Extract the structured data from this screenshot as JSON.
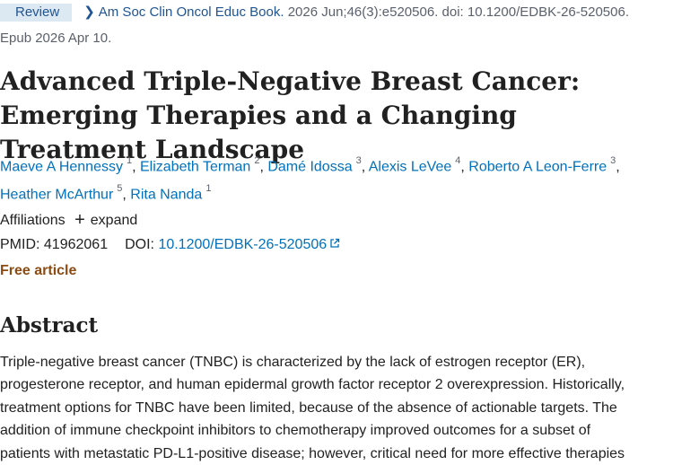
{
  "header": {
    "badge": "Review",
    "journal": "Am Soc Clin Oncol Educ Book.",
    "citation": " 2026 Jun;46(3):e520506. doi: 10.1200/EDBK-26-520506.",
    "epub": "Epub 2026 Apr 10."
  },
  "title": "Advanced Triple-Negative Breast Cancer: Emerging Therapies and a Changing Treatment Landscape",
  "authors": [
    {
      "name": "Maeve A Hennessy",
      "aff": "1"
    },
    {
      "name": "Elizabeth Terman",
      "aff": "2"
    },
    {
      "name": "Damé Idossa",
      "aff": "3"
    },
    {
      "name": "Alexis LeVee",
      "aff": "4"
    },
    {
      "name": "Roberto A Leon-Ferre",
      "aff": "3"
    },
    {
      "name": "Heather McArthur",
      "aff": "5"
    },
    {
      "name": "Rita Nanda",
      "aff": "1"
    }
  ],
  "affiliations": {
    "label": "Affiliations",
    "expand_label": "expand"
  },
  "identifiers": {
    "pmid_label": "PMID:",
    "pmid": "41962061",
    "doi_label": "DOI:",
    "doi": "10.1200/EDBK-26-520506"
  },
  "free_article": "Free article",
  "abstract": {
    "heading": "Abstract",
    "lines": [
      "Triple-negative breast cancer (TNBC) is characterized by the lack of estrogen receptor (ER),",
      "progesterone receptor, and human epidermal growth factor receptor 2 overexpression. Historically,",
      "treatment options for TNBC have been limited, because of the absence of actionable targets. The",
      "addition of immune checkpoint inhibitors to chemotherapy improved outcomes for a subset of",
      "patients with metastatic PD-L1-positive disease; however, critical need for more effective therapies"
    ]
  },
  "colors": {
    "link": "#0071bc",
    "badge_bg": "#dce8f2",
    "badge_text": "#205493",
    "free_article": "#8b4b12"
  }
}
